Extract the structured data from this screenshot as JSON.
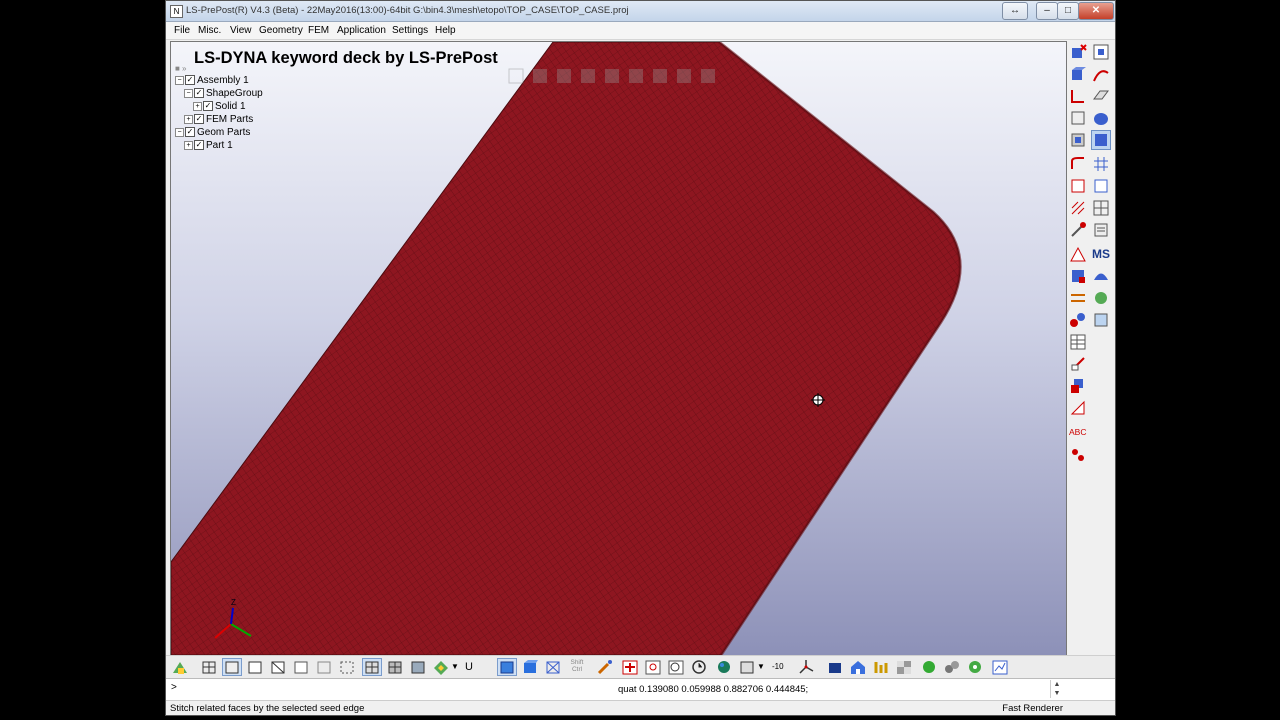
{
  "window": {
    "title": "LS-PrePost(R) V4.3 (Beta) - 22May2016(13:00)-64bit G:\\bin4.3\\mesh\\etopo\\TOP_CASE\\TOP_CASE.proj",
    "app_icon_glyph": "N"
  },
  "menu": [
    "File",
    "Misc.",
    "View",
    "Geometry",
    "FEM",
    "Application",
    "Settings",
    "Help"
  ],
  "viewport": {
    "heading": "LS-DYNA keyword deck by LS-PrePost",
    "mesh_color": "#8e1620",
    "axis_labels": {
      "z": "Z"
    }
  },
  "tree": {
    "assembly": "Assembly 1",
    "shape_group": "ShapeGroup",
    "solid": "Solid 1",
    "fem_parts": "FEM Parts",
    "geom_parts": "Geom Parts",
    "part": "Part 1"
  },
  "right_toolbar": {
    "ms_label": "MS",
    "abc_label": "ABC"
  },
  "bottom_toolbar": {
    "u_label": "U",
    "shift_ctrl": "Shift\nCtrl",
    "minus_ten": "-10"
  },
  "command": {
    "prompt": ">",
    "quat": "quat 0.139080 0.059988 0.882706 0.444845;"
  },
  "status": {
    "message": "Stitch related faces by the selected seed edge",
    "renderer": "Fast Renderer"
  }
}
